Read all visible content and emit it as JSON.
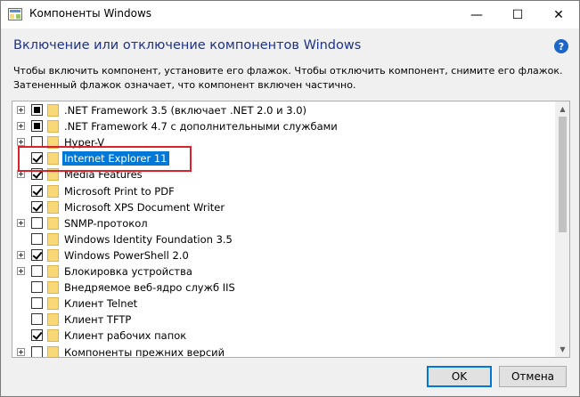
{
  "window": {
    "title": "Компоненты Windows",
    "minimize_glyph": "—",
    "maximize_glyph": "☐",
    "close_glyph": "✕"
  },
  "header": {
    "title": "Включение или отключение компонентов Windows",
    "help_glyph": "?"
  },
  "description": {
    "line1": "Чтобы включить компонент, установите его флажок. Чтобы отключить компонент, снимите его флажок.",
    "line2": "Затененный флажок означает, что компонент включен частично."
  },
  "features": [
    {
      "label": ".NET Framework 3.5 (включает .NET 2.0 и 3.0)",
      "state": "partial",
      "expandable": true,
      "selected": false
    },
    {
      "label": ".NET Framework 4.7 с дополнительными службами",
      "state": "partial",
      "expandable": true,
      "selected": false
    },
    {
      "label": "Hyper-V",
      "state": "unchecked",
      "expandable": true,
      "selected": false
    },
    {
      "label": "Internet Explorer 11",
      "state": "checked",
      "expandable": false,
      "selected": true
    },
    {
      "label": "Media Features",
      "state": "checked",
      "expandable": true,
      "selected": false
    },
    {
      "label": "Microsoft Print to PDF",
      "state": "checked",
      "expandable": false,
      "selected": false
    },
    {
      "label": "Microsoft XPS Document Writer",
      "state": "checked",
      "expandable": false,
      "selected": false
    },
    {
      "label": "SNMP-протокол",
      "state": "unchecked",
      "expandable": true,
      "selected": false
    },
    {
      "label": "Windows Identity Foundation 3.5",
      "state": "unchecked",
      "expandable": false,
      "selected": false
    },
    {
      "label": "Windows PowerShell 2.0",
      "state": "checked",
      "expandable": true,
      "selected": false
    },
    {
      "label": "Блокировка устройства",
      "state": "unchecked",
      "expandable": true,
      "selected": false
    },
    {
      "label": "Внедряемое веб-ядро служб IIS",
      "state": "unchecked",
      "expandable": false,
      "selected": false
    },
    {
      "label": "Клиент Telnet",
      "state": "unchecked",
      "expandable": false,
      "selected": false
    },
    {
      "label": "Клиент TFTP",
      "state": "unchecked",
      "expandable": false,
      "selected": false
    },
    {
      "label": "Клиент рабочих папок",
      "state": "checked",
      "expandable": false,
      "selected": false
    },
    {
      "label": "Компоненты прежних версий",
      "state": "unchecked",
      "expandable": true,
      "selected": false
    }
  ],
  "scrollbar": {
    "up_glyph": "▲",
    "down_glyph": "▼"
  },
  "buttons": {
    "ok": "OK",
    "cancel": "Отмена"
  },
  "colors": {
    "accent": "#0078d7",
    "header": "#1e3287",
    "annotation": "#d9222a"
  }
}
